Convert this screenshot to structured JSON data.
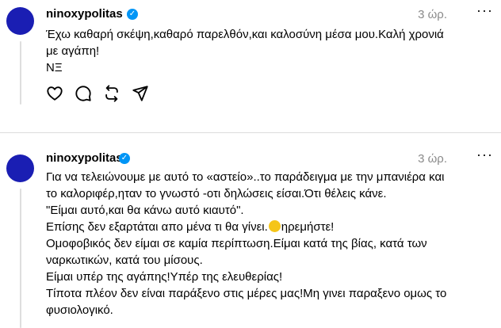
{
  "posts": [
    {
      "username": "ninoxypolitas",
      "verified": true,
      "time": "3 ώρ.",
      "more": "···",
      "lines": [
        "Έχω καθαρή σκέψη,καθαρό παρελθόν,και καλοσύνη μέσα μου.Καλή χρονιά",
        "με αγάπη!",
        "ΝΞ"
      ],
      "actions": [
        "like-icon",
        "comment-icon",
        "repost-icon",
        "share-icon"
      ]
    },
    {
      "username": "ninoxypolitas",
      "verified": true,
      "time": "3 ώρ.",
      "more": "···",
      "lines": [
        "Για να τελειώνουμε με αυτό το «αστείο»..το παράδειγμα με την μπανιέρα και",
        "το καλοριφέρ,ηταν το γνωστό -οτι δηλώσεις είσαι.Ότι θέλεις κάνε.",
        "\"Είμαι αυτό,και θα κάνω αυτό κιαυτό\".",
        "Επίσης δεν εξαρτάται απο μένα τι θα γίνει.",
        "ηρεμήστε!",
        "Ομοφοβικός δεν είμαι σε καμία περίπτωση.Είμαι κατά της βίας, κατά των",
        "ναρκωτικών, κατά του μίσους.",
        "Είμαι υπέρ της αγάπης!Υπέρ της ελευθερίας!",
        "Τίποτα πλέον δεν είναι παράξενο στις μέρες μας!Μη γινει παραξενο ομως το",
        "φυσιολογικό."
      ],
      "emoji": "grinning-sweat-emoji"
    }
  ],
  "colors": {
    "avatar": "#1a1eb3",
    "verified": "#0095f6",
    "time": "#8a8a8a",
    "divider": "#dcdcdc"
  }
}
